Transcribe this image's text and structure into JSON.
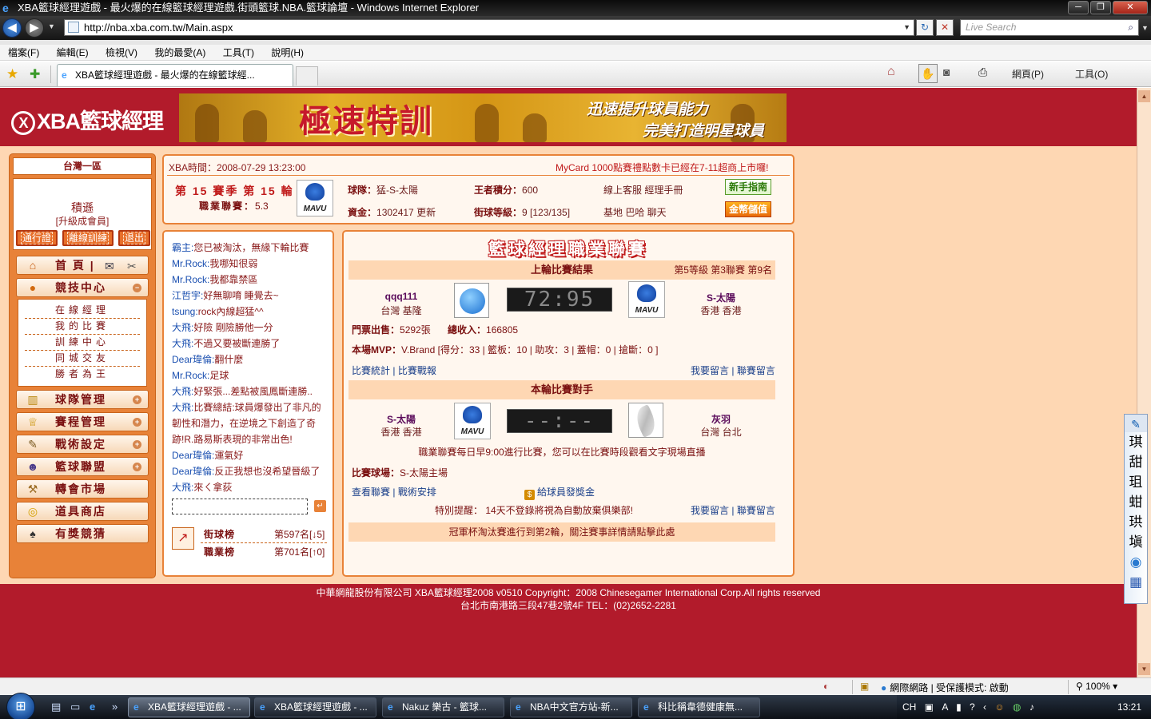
{
  "browser": {
    "window_title": "XBA籃球經理遊戲 - 最火爆的在線籃球經理遊戲.街頭籃球.NBA.籃球論壇 - Windows Internet Explorer",
    "url": "http://nba.xba.com.tw/Main.aspx",
    "search_placeholder": "Live Search",
    "menu": [
      "檔案(F)",
      "編輯(E)",
      "檢視(V)",
      "我的最愛(A)",
      "工具(T)",
      "說明(H)"
    ],
    "tab_title": "XBA籃球經理遊戲 - 最火爆的在線籃球經...",
    "page_menu": "網頁(P)",
    "tools_menu": "工具(O)"
  },
  "site": {
    "logo_mark": "X",
    "logo_text": "XBA籃球經理",
    "banner_main": "極速特訓",
    "banner_sub1": "迅速提升球員能力",
    "banner_sub2": "完美打造明星球員"
  },
  "sidebar": {
    "server": "台灣一區",
    "username": "積遜",
    "level": "[升級成會員]",
    "buttons": [
      "通行證",
      "離線訓練",
      "退出"
    ],
    "home_label": "首 頁 |",
    "competition_label": "競技中心",
    "submenu": [
      "在線經理",
      "我的比賽",
      "訓練中心",
      "同城交友",
      "勝者為王"
    ],
    "menu_items": [
      "球隊管理",
      "賽程管理",
      "戰術設定",
      "籃球聯盟",
      "轉會市場",
      "道具商店",
      "有獎競猜"
    ]
  },
  "info": {
    "time_label": "XBA時間：",
    "time_value": "2008-07-29 13:23:00",
    "marquee": "MyCard 1000點賽禮點數卡已經在7-11超商上市囉!",
    "season": "第 15 賽季 第 15 輪",
    "league_label": "職業聯賽：",
    "league_value": "5.3",
    "team_logo_text": "MAVU",
    "team_label": "球隊：",
    "team_value": "猛-S-太陽",
    "funds_label": "資金：",
    "funds_value": "1302417",
    "refresh": "更新",
    "king_label": "王者積分：",
    "king_value": "600",
    "street_label": "街球等級：",
    "street_value": "9 [123/135]",
    "links1": "線上客服  經理手冊",
    "links2": "基地  巴哈  聊天",
    "newbie_button": "新手指南",
    "topup_button": "金幣儲值"
  },
  "chat": {
    "messages": [
      {
        "name": "霸主:",
        "text": "您已被淘汰，無緣下輪比賽"
      },
      {
        "name": "Mr.Rock:",
        "text": "我哪知很弱"
      },
      {
        "name": "Mr.Rock:",
        "text": "我都靠禁區"
      },
      {
        "name": "江哲宇:",
        "text": "好無聊唷  睡覺去~"
      },
      {
        "name": "tsung:",
        "text": "rock內線超猛^^"
      },
      {
        "name": "大飛:",
        "text": "好險  剛險勝他一分"
      },
      {
        "name": "大飛:",
        "text": "不過又要被斷連勝了"
      },
      {
        "name": "Dear瑋倫:",
        "text": "翻什麼"
      },
      {
        "name": "Mr.Rock:",
        "text": "足球"
      },
      {
        "name": "大飛:",
        "text": "好緊張...差點被風鳳斷連勝.."
      },
      {
        "name": "大飛:",
        "text": "比賽總結:球員爆發出了非凡的韌性和潛力，在逆境之下創造了奇跡!R.路易斯表現的非常出色!"
      },
      {
        "name": "Dear瑋倫:",
        "text": "運氣好"
      },
      {
        "name": "Dear瑋倫:",
        "text": "反正我想也沒希望晉級了"
      },
      {
        "name": "大飛:",
        "text": "來ㄑ拿荻"
      }
    ],
    "send_icon": "↵",
    "rank1_label": "街球榜",
    "rank1_value": "第597名[↓5]",
    "rank2_label": "職業榜",
    "rank2_value": "第701名[↑0]"
  },
  "league": {
    "title": "籃球經理職業聯賽",
    "last_round_title": "上輪比賽結果",
    "last_round_info": "第5等級  第3聯賽  第9名",
    "home_team": "qqq111",
    "home_loc": "台灣 基隆",
    "score": "72:95",
    "away_team": "S-太陽",
    "away_loc": "香港 香港",
    "away_logo_text": "MAVU",
    "ticket_label": "門票出售：",
    "ticket_value": "5292張",
    "revenue_label": "總收入：",
    "revenue_value": "166805",
    "mvp_label": "本場MVP：",
    "mvp_value": "V.Brand [得分：33 | 籃板：10 | 助攻：3 | 蓋帽：0 | 搶斷：0 ]",
    "stats_link": "比賽統計",
    "report_link": "比賽戰報",
    "msg_link1": "我要留言",
    "msg_link2": "聯賽留言",
    "next_title": "本輪比賽對手",
    "next_home": "S-太陽",
    "next_home_loc": "香港 香港",
    "next_home_logo_text": "MAVU",
    "next_score": "--:--",
    "next_away": "灰羽",
    "next_away_loc": "台灣 台北",
    "schedule_note": "職業聯賽每日早9:00進行比賽，您可以在比賽時段觀看文字現場直播",
    "venue_label": "比賽球場：",
    "venue_value": "S-太陽主場",
    "view_league": "查看聯賽",
    "tactics": "戰術安排",
    "bonus_icon": "$",
    "bonus_link": "給球員發獎金",
    "reminder": "特別提醒：  14天不登錄將視為自動放棄俱樂部!",
    "notice": "冠軍杯淘汰賽進行到第2輪，關注賽事詳情請點擊此處"
  },
  "footer": {
    "line1": "中華網龍股份有限公司  XBA籃球經理2008 v0510     Copyright：2008 Chinesegamer International Corp.All rights reserved",
    "line2": "台北市南港路三段47巷2號4F TEL：(02)2652-2281"
  },
  "ime": [
    "琪",
    "甜",
    "珇",
    "蚶",
    "珙",
    "塡"
  ],
  "status": {
    "zone": "網際網路 | 受保護模式: 啟動",
    "zoom": "100%"
  },
  "taskbar": {
    "buttons": [
      "XBA籃球經理遊戲 - ...",
      "XBA籃球經理遊戲 - ...",
      "Nakuz 樂古 - 籃球...",
      "NBA中文官方站-新...",
      "科比稱韋德健康無..."
    ],
    "lang": "CH",
    "clock": "13:21"
  },
  "colors": {
    "page_red": "#b21b2b",
    "panel_peach": "#fed7b3",
    "panel_orange": "#e88238",
    "text_darkred": "#7a1010",
    "link_blue": "#1a3f8a"
  }
}
